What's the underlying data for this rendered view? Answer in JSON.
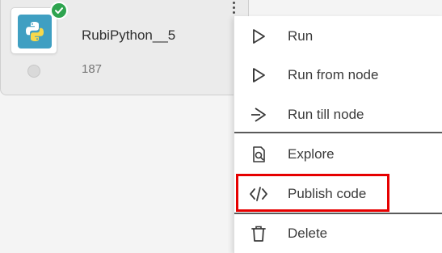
{
  "node": {
    "title": "RubiPython__5",
    "count": "187",
    "icon": "python-icon",
    "status": "success-check-icon",
    "colors": {
      "icon_bg": "#3f9fc2",
      "status": "#2ea44f"
    }
  },
  "context_menu": {
    "items": [
      {
        "label": "Run",
        "icon": "run-icon"
      },
      {
        "label": "Run from node",
        "icon": "run-from-node-icon"
      },
      {
        "label": "Run till node",
        "icon": "run-till-node-icon"
      },
      {
        "label": "Explore",
        "icon": "explore-icon"
      },
      {
        "label": "Publish code",
        "icon": "code-icon",
        "highlighted": true
      },
      {
        "label": "Delete",
        "icon": "trash-icon"
      }
    ],
    "highlight_color": "#e60000"
  }
}
